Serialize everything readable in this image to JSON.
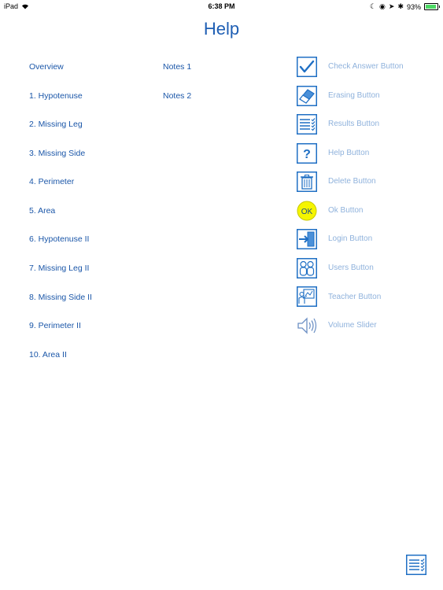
{
  "status": {
    "device": "iPad",
    "time": "6:38 PM",
    "battery_percent": "93%",
    "battery_level": 0.93
  },
  "title": "Help",
  "topics_col1": [
    "Overview",
    "1.  Hypotenuse",
    "2.  Missing Leg",
    "3. Missing Side",
    "4. Perimeter",
    "5. Area",
    "6.  Hypotenuse II",
    "7.  Missing Leg II",
    "8. Missing Side II",
    "9. Perimeter II",
    "10. Area II"
  ],
  "topics_col2": [
    "Notes 1",
    "Notes 2"
  ],
  "buttons": [
    {
      "icon": "checkmark-icon",
      "label": "Check Answer Button"
    },
    {
      "icon": "eraser-icon",
      "label": "Erasing Button"
    },
    {
      "icon": "results-list-icon",
      "label": "Results Button"
    },
    {
      "icon": "question-mark-icon",
      "label": "Help Button",
      "glyph": "?"
    },
    {
      "icon": "trash-icon",
      "label": "Delete Button"
    },
    {
      "icon": "ok-circle-icon",
      "label": "Ok Button",
      "glyph": "OK"
    },
    {
      "icon": "login-door-icon",
      "label": "Login Button"
    },
    {
      "icon": "users-icon",
      "label": "Users Button"
    },
    {
      "icon": "teacher-icon",
      "label": "Teacher Button"
    },
    {
      "icon": "speaker-icon",
      "label": "Volume Slider"
    }
  ],
  "colors": {
    "link": "#1a56a8",
    "title": "#1f5fb4",
    "muted_label": "#8fb2dc",
    "icon_blue": "#1f6fc4",
    "ok_yellow": "#f5f500"
  }
}
